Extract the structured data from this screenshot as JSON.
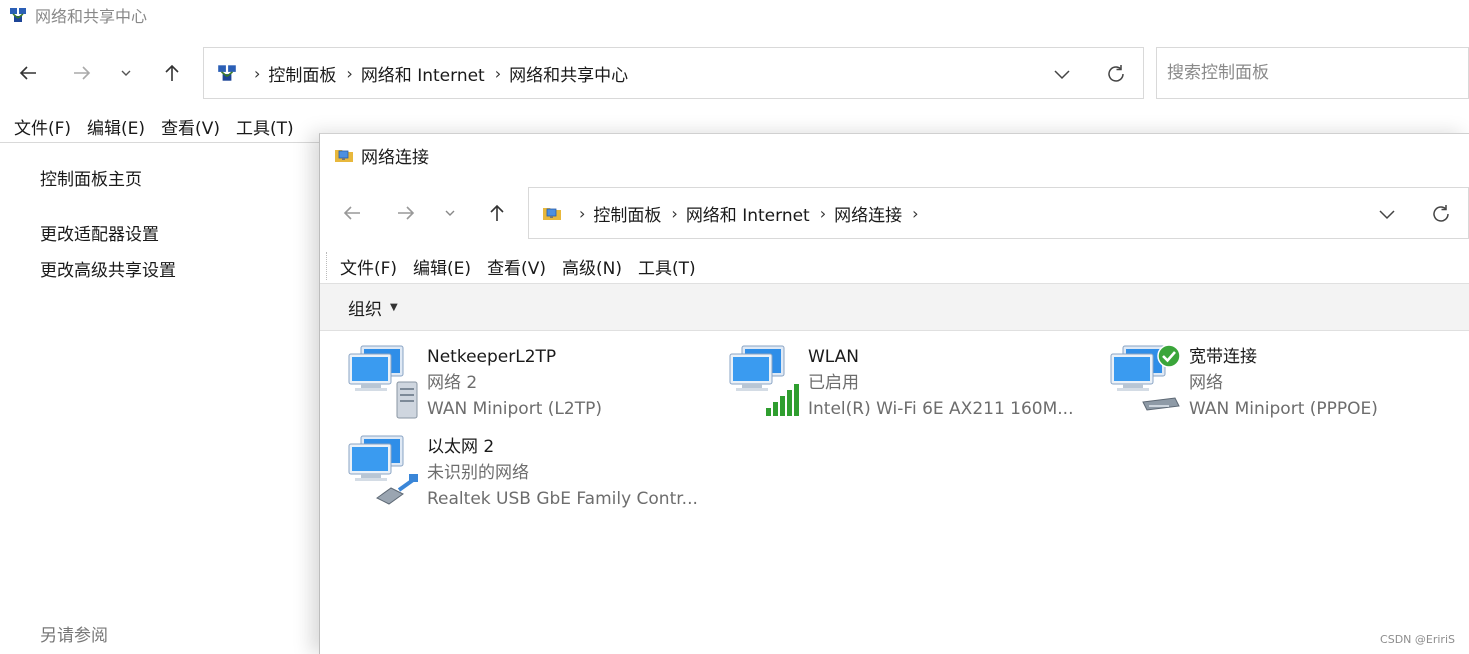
{
  "back_window": {
    "title": "网络和共享中心",
    "breadcrumb": [
      "控制面板",
      "网络和 Internet",
      "网络和共享中心"
    ],
    "search_placeholder": "搜索控制面板",
    "menu": [
      "文件(F)",
      "编辑(E)",
      "查看(V)",
      "工具(T)"
    ],
    "sidebar": {
      "home": "控制面板主页",
      "adapter_settings": "更改适配器设置",
      "advanced_sharing": "更改高级共享设置",
      "see_also": "另请参阅"
    }
  },
  "front_window": {
    "title": "网络连接",
    "breadcrumb": [
      "控制面板",
      "网络和 Internet",
      "网络连接"
    ],
    "menu": [
      "文件(F)",
      "编辑(E)",
      "查看(V)",
      "高级(N)",
      "工具(T)"
    ],
    "organize_label": "组织",
    "connections": [
      {
        "name": "NetkeeperL2TP",
        "status": "网络 2",
        "device": "WAN Miniport (L2TP)",
        "icon": "vpn-server-connection-icon"
      },
      {
        "name": "WLAN",
        "status": "已启用",
        "device": "Intel(R) Wi-Fi 6E AX211 160M...",
        "icon": "wifi-signal-connection-icon"
      },
      {
        "name": "宽带连接",
        "status": "网络",
        "device": "WAN Miniport (PPPOE)",
        "icon": "broadband-connected-icon"
      },
      {
        "name": "以太网 2",
        "status": "未识别的网络",
        "device": "Realtek USB GbE Family Contr...",
        "icon": "ethernet-cable-connection-icon"
      }
    ]
  },
  "watermark": "CSDN @EririS",
  "colors": {
    "accent": "#1a6fd6",
    "connected_green": "#3aa53a",
    "wifi_green": "#2f9e2f"
  }
}
